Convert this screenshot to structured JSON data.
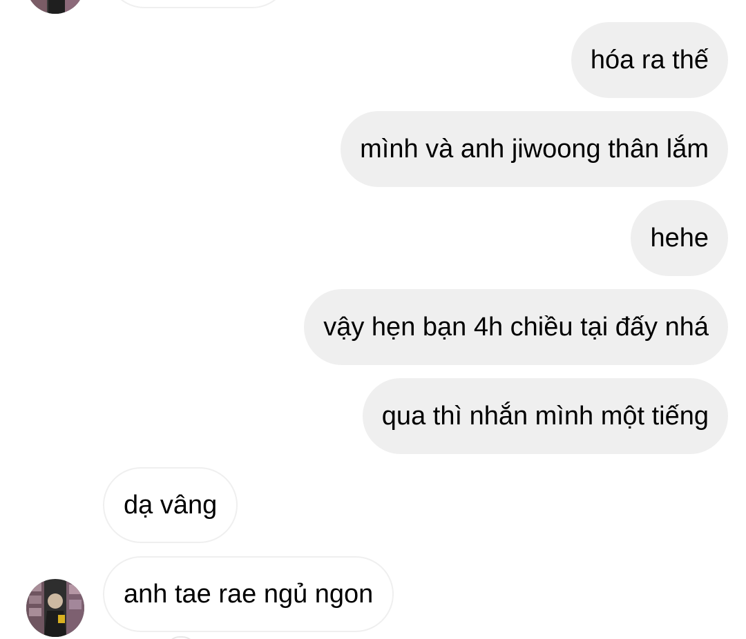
{
  "conversation": {
    "messages": [
      {
        "direction": "outgoing",
        "text": "hóa ra thế"
      },
      {
        "direction": "outgoing",
        "text": "mình và anh jiwoong thân lắm"
      },
      {
        "direction": "outgoing",
        "text": "hehe"
      },
      {
        "direction": "outgoing",
        "text": "vậy hẹn bạn 4h chiều tại đấy nhá"
      },
      {
        "direction": "outgoing",
        "text": "qua thì nhắn mình một tiếng"
      },
      {
        "direction": "incoming",
        "text": "dạ vâng"
      },
      {
        "direction": "incoming",
        "text": "anh tae rae ngủ ngon"
      }
    ]
  },
  "colors": {
    "outgoing_bubble": "#efefef",
    "incoming_border": "#efefef",
    "text": "#000000",
    "background": "#ffffff"
  },
  "icons": {
    "avatar": "contact-avatar"
  }
}
